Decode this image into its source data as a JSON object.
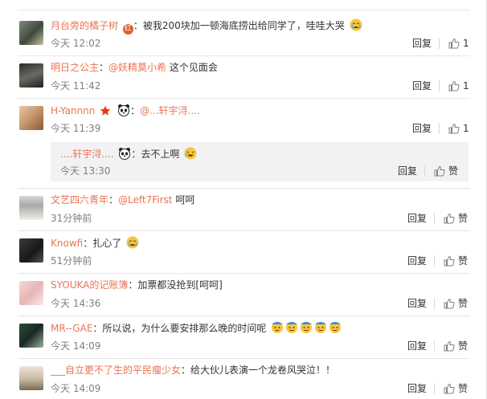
{
  "comments": [
    {
      "user": "月台旁的橘子树",
      "badge": "红",
      "content": "被我200块加一顿海底捞出给同学了，哇哇大哭",
      "time": "今天 12:02",
      "reply_label": "回复",
      "likes": "1"
    },
    {
      "user": "明日之公主",
      "colon": "：",
      "mention": "@妖精莫小希",
      "content": " 这个见面会",
      "time": "今天 11:42",
      "reply_label": "回复",
      "likes": "1"
    },
    {
      "user": "H-Yannnn",
      "colon": "：",
      "mention": "@...轩宇浔....",
      "time": "今天 11:39",
      "reply_label": "回复",
      "likes": "1"
    },
    {
      "user": "文艺四六青年",
      "colon": "：",
      "mention": "@Left7First",
      "content": " 呵呵",
      "time": "31分钟前",
      "reply_label": "回复",
      "likes": "赞"
    },
    {
      "user": "Knowfi",
      "content": "扎心了",
      "time": "51分钟前",
      "reply_label": "回复",
      "likes": "赞"
    },
    {
      "user": "SYOUKA的记账簿",
      "content": "加票都没抢到[呵呵]",
      "time": "今天 14:36",
      "reply_label": "回复",
      "likes": "赞"
    },
    {
      "user": "MR--GAE",
      "content": "所以说，为什么要安排那么晚的时间呢",
      "time": "今天 14:09",
      "reply_label": "回复",
      "likes": "赞"
    },
    {
      "user": "___自立更不了生的平民瘤少女",
      "content": "给大伙儿表演一个龙卷风哭泣！！",
      "time": "今天 14:09",
      "reply_label": "回复",
      "likes": "赞"
    }
  ],
  "sub_reply": {
    "user": "....轩宇浔....",
    "content": "去不上啊",
    "time": "今天 13:30",
    "reply_label": "回复",
    "likes": "赞"
  },
  "colon": "：",
  "icons": [
    "like-thumb-icon",
    "crying-emoji-icon",
    "panda-icon",
    "star-badge-icon",
    "laughing-emoji-icon"
  ],
  "colors": {
    "username": "#eb7350",
    "text": "#333333",
    "time": "#808080",
    "sub_bg": "#f2f2f5"
  }
}
